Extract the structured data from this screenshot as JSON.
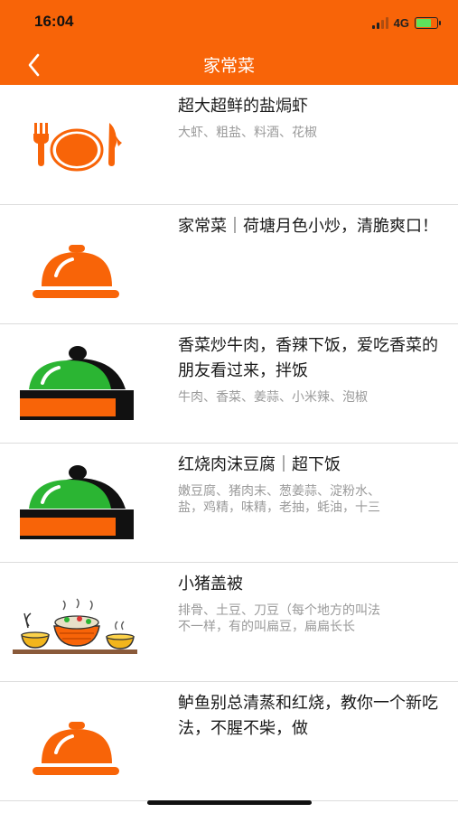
{
  "status_bar": {
    "time": "16:04",
    "network": "4G",
    "battery_level": 0.75
  },
  "header": {
    "title": "家常菜",
    "back_icon": "chevron-left-icon",
    "accent": "#f86408"
  },
  "recipes": [
    {
      "icon": "plate-fork-knife-icon",
      "title": "超大超鲜的盐焗虾",
      "ingredients": "大虾、粗盐、料酒、花椒"
    },
    {
      "icon": "orange-cloche-icon",
      "title": "家常菜｜荷塘月色小炒，清脆爽口！",
      "ingredients": ""
    },
    {
      "icon": "green-cloche-icon",
      "title": "香菜炒牛肉，香辣下饭，爱吃香菜的朋友看过来，拌饭",
      "ingredients": "牛肉、香菜、姜蒜、小米辣、泡椒"
    },
    {
      "icon": "green-cloche-icon",
      "title": "红烧肉沫豆腐｜超下饭",
      "ingredients": "嫩豆腐、猪肉末、葱姜蒜、淀粉水、\n盐，鸡精，味精，老抽，蚝油，十三"
    },
    {
      "icon": "dishes-table-icon",
      "title": "小猪盖被",
      "ingredients": "排骨、土豆、刀豆（每个地方的叫法\n不一样，有的叫扁豆，扁扁长长"
    },
    {
      "icon": "orange-cloche-icon",
      "title": "鲈鱼别总清蒸和红烧，教你一个新吃法，不腥不柴，做",
      "ingredients": ""
    }
  ]
}
